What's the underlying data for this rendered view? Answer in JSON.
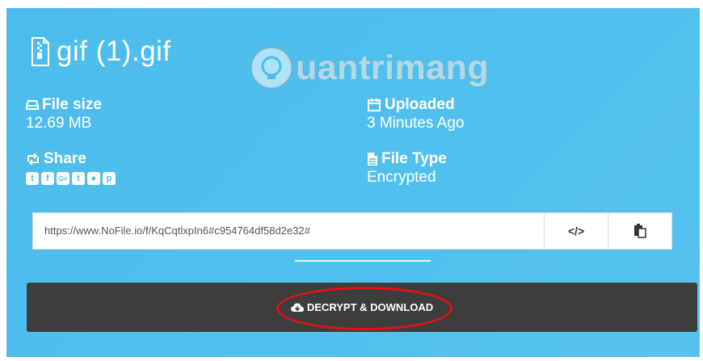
{
  "file": {
    "name": "gif (1).gif"
  },
  "watermark": {
    "text": "uantrimang"
  },
  "info": {
    "size": {
      "label": "File size",
      "value": "12.69 MB"
    },
    "uploaded": {
      "label": "Uploaded",
      "value": "3 Minutes Ago"
    },
    "share": {
      "label": "Share",
      "icons": [
        "twitter-icon",
        "facebook-icon",
        "google-plus-icon",
        "tumblr-icon",
        "reddit-icon",
        "pinterest-icon"
      ]
    },
    "type": {
      "label": "File Type",
      "value": "Encrypted"
    }
  },
  "url_bar": {
    "url": "https://www.NoFile.io/f/KqCqtlxpIn6#c954764df58d2e32#",
    "embed_label": "</>",
    "copy_icon": "clipboard-icon"
  },
  "download": {
    "label": "DECRYPT & DOWNLOAD",
    "icon": "cloud-download-icon"
  },
  "colors": {
    "panel": "#4cbcec",
    "download_bar": "#3d3d3b",
    "highlight": "#e0121a"
  }
}
